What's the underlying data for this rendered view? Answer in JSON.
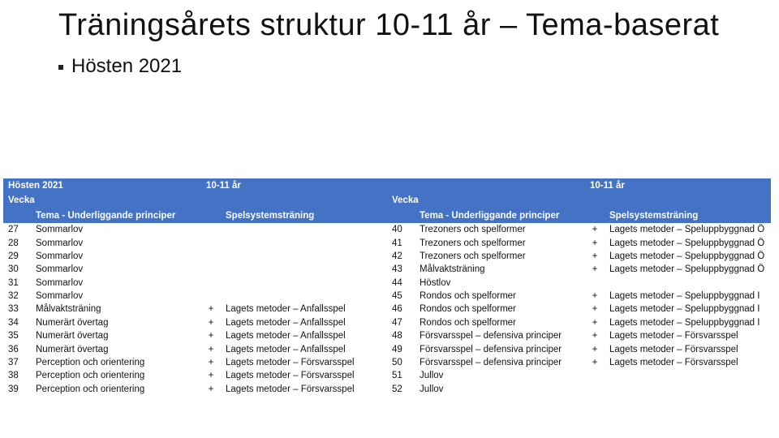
{
  "title": "Träningsårets struktur 10-11 år – Tema-baserat",
  "bullet": "Hösten 2021",
  "hdr": {
    "season": "Hösten 2021",
    "age": "10-11 år",
    "week": "Vecka",
    "theme": "Tema - Underliggande principer",
    "system": "Spelsystemsträning"
  },
  "left": [
    {
      "w": "27",
      "t": "Sommarlov",
      "p": "",
      "s": ""
    },
    {
      "w": "28",
      "t": "Sommarlov",
      "p": "",
      "s": ""
    },
    {
      "w": "29",
      "t": "Sommarlov",
      "p": "",
      "s": ""
    },
    {
      "w": "30",
      "t": "Sommarlov",
      "p": "",
      "s": ""
    },
    {
      "w": "31",
      "t": "Sommarlov",
      "p": "",
      "s": ""
    },
    {
      "w": "32",
      "t": "Sommarlov",
      "p": "",
      "s": ""
    },
    {
      "w": "33",
      "t": "Målvaktsträning",
      "p": "+",
      "s": "Lagets metoder – Anfallsspel"
    },
    {
      "w": "34",
      "t": "Numerärt övertag",
      "p": "+",
      "s": "Lagets metoder – Anfallsspel"
    },
    {
      "w": "35",
      "t": "Numerärt övertag",
      "p": "+",
      "s": "Lagets metoder – Anfallsspel"
    },
    {
      "w": "36",
      "t": "Numerärt övertag",
      "p": "+",
      "s": "Lagets metoder – Anfallsspel"
    },
    {
      "w": "37",
      "t": "Perception och orientering",
      "p": "+",
      "s": "Lagets metoder – Försvarsspel"
    },
    {
      "w": "38",
      "t": "Perception och orientering",
      "p": "+",
      "s": "Lagets metoder – Försvarsspel"
    },
    {
      "w": "39",
      "t": "Perception och orientering",
      "p": "+",
      "s": "Lagets metoder – Försvarsspel"
    }
  ],
  "right": [
    {
      "w": "40",
      "t": "Trezoners och spelformer",
      "p": "+",
      "s": "Lagets metoder – Speluppbyggnad Ö"
    },
    {
      "w": "41",
      "t": "Trezoners och spelformer",
      "p": "+",
      "s": "Lagets metoder – Speluppbyggnad Ö"
    },
    {
      "w": "42",
      "t": "Trezoners och spelformer",
      "p": "+",
      "s": "Lagets metoder – Speluppbyggnad Ö"
    },
    {
      "w": "43",
      "t": "Målvaktsträning",
      "p": "+",
      "s": "Lagets metoder – Speluppbyggnad Ö"
    },
    {
      "w": "44",
      "t": "Höstlov",
      "p": "",
      "s": ""
    },
    {
      "w": "45",
      "t": "Rondos och spelformer",
      "p": "+",
      "s": "Lagets metoder – Speluppbyggnad I"
    },
    {
      "w": "46",
      "t": "Rondos och spelformer",
      "p": "+",
      "s": "Lagets metoder – Speluppbyggnad I"
    },
    {
      "w": "47",
      "t": "Rondos och spelformer",
      "p": "+",
      "s": "Lagets metoder – Speluppbyggnad I"
    },
    {
      "w": "48",
      "t": "Försvarsspel – defensiva principer",
      "p": "+",
      "s": "Lagets metoder – Försvarsspel"
    },
    {
      "w": "49",
      "t": "Försvarsspel – defensiva principer",
      "p": "+",
      "s": "Lagets metoder – Försvarsspel"
    },
    {
      "w": "50",
      "t": "Försvarsspel – defensiva principer",
      "p": "+",
      "s": "Lagets metoder – Försvarsspel"
    },
    {
      "w": "51",
      "t": "Jullov",
      "p": "",
      "s": ""
    },
    {
      "w": "52",
      "t": "Jullov",
      "p": "",
      "s": ""
    }
  ]
}
